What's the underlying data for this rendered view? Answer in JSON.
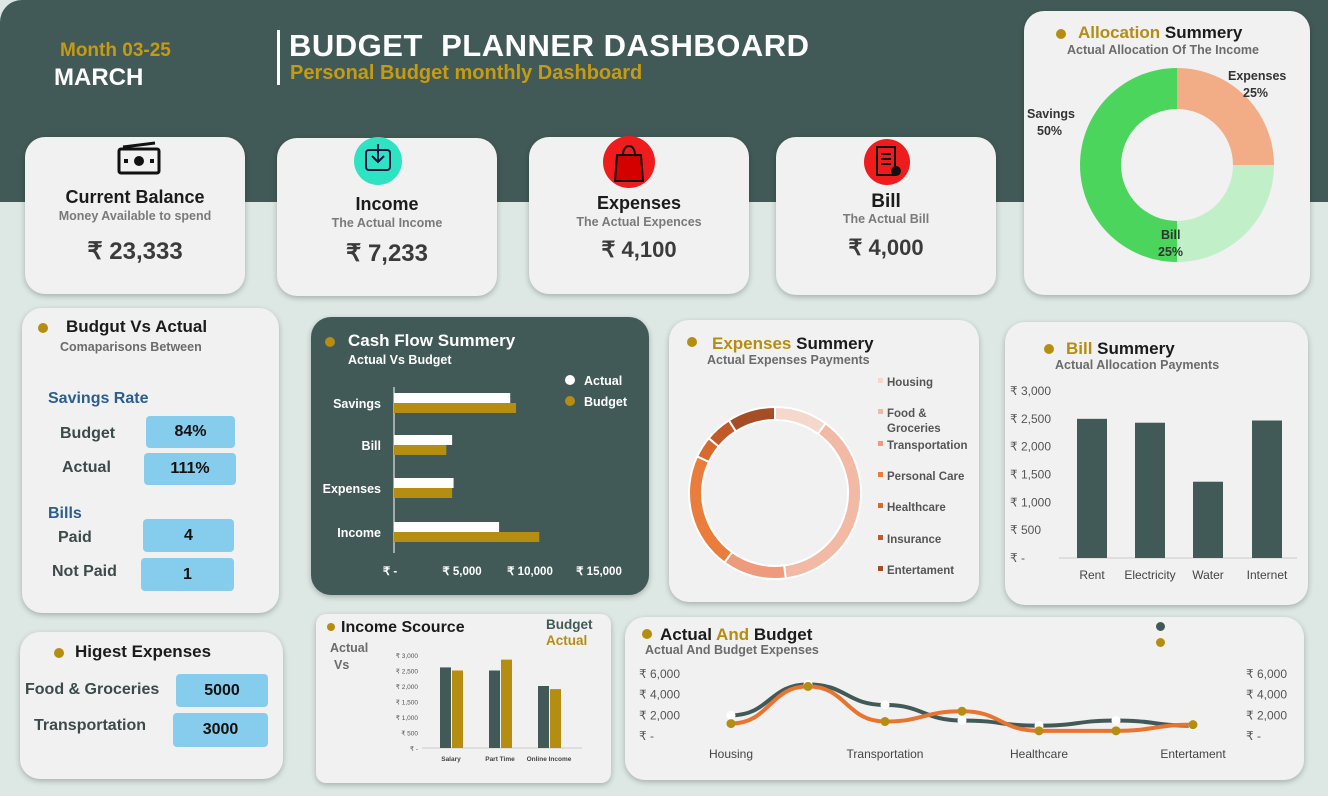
{
  "header": {
    "month_code": "Month 03-25",
    "month_name": "MARCH",
    "title": "BUDGET  PLANNER DASHBOARD",
    "subtitle": "Personal Budget monthly Dashboard"
  },
  "kpis": [
    {
      "title": "Current Balance",
      "sub": "Money Available to spend",
      "value": "₹ 23,333",
      "icon": "cash-icon"
    },
    {
      "title": "Income",
      "sub": "The Actual Income",
      "value": "₹ 7,233",
      "icon": "income-download-icon"
    },
    {
      "title": "Expenses",
      "sub": "The Actual Expences",
      "value": "₹ 4,100",
      "icon": "shopping-bag-icon"
    },
    {
      "title": "Bill",
      "sub": "The Actual Bill",
      "value": "₹ 4,000",
      "icon": "receipt-icon"
    }
  ],
  "allocation": {
    "title_a": "Allocation",
    "title_b": " Summery",
    "sub": "Actual Allocation Of The Income",
    "labels": {
      "expenses": "Expenses",
      "expenses_pct": "25%",
      "savings": "Savings",
      "savings_pct": "50%",
      "bill": "Bill",
      "bill_pct": "25%"
    }
  },
  "budget_vs_actual": {
    "title": "Budgut Vs Actual",
    "sub": "Comaparisons Between",
    "savings_rate_label": "Savings Rate",
    "budget_label": "Budget",
    "budget_value": "84%",
    "actual_label": "Actual",
    "actual_value": "111%",
    "bills_label": "Bills",
    "paid_label": "Paid",
    "paid_value": "4",
    "notpaid_label": "Not Paid",
    "notpaid_value": "1"
  },
  "highest_expenses": {
    "title": "Higest Expenses",
    "items": [
      {
        "label": "Food & Groceries",
        "value": "5000"
      },
      {
        "label": "Transportation",
        "value": "3000"
      }
    ]
  },
  "cash_flow": {
    "title": "Cash Flow Summery",
    "sub": "Actual Vs Budget",
    "legend_actual": "Actual",
    "legend_budget": "Budget",
    "x_ticks": [
      "₹ -",
      "₹ 5,000",
      "₹ 10,000",
      "₹ 15,000"
    ]
  },
  "expenses_summary": {
    "title_a": "Expenses",
    "title_b": " Summery",
    "sub": "Actual Expenses Payments",
    "legend": [
      "Housing",
      "Food &",
      "Groceries",
      "Transportation",
      "Personal Care",
      "Healthcare",
      "Insurance",
      "Entertament"
    ]
  },
  "bill_summary": {
    "title_a": "Bill",
    "title_b": " Summery",
    "sub": "Actual Allocation Payments",
    "y_ticks": [
      "₹ 3,000",
      "₹ 2,500",
      "₹ 2,000",
      "₹ 1,500",
      "₹ 1,000",
      "₹ 500",
      "₹ -"
    ]
  },
  "income_source": {
    "title": "Income Scource",
    "left_a": "Actual",
    "left_b": "Vs",
    "legend_budget": "Budget",
    "legend_actual": "Actual",
    "y_ticks": [
      "₹ 3,000",
      "₹ 2,500",
      "₹ 2,000",
      "₹ 1,500",
      "₹ 1,000",
      "₹ 500",
      "₹ -"
    ]
  },
  "actual_budget": {
    "title_a": "Actual",
    "title_mid": " And ",
    "title_b": "Budget",
    "sub": "Actual And Budget Expenses",
    "y_ticks": [
      "₹ 6,000",
      "₹ 4,000",
      "₹ 2,000",
      "₹ -"
    ]
  },
  "chart_data": [
    {
      "type": "pie",
      "title": "Allocation Summery",
      "categories": [
        "Expenses",
        "Bill",
        "Savings"
      ],
      "values": [
        25,
        25,
        50
      ],
      "colors": [
        "#f3ad86",
        "#c1efc8",
        "#4bd55c"
      ]
    },
    {
      "type": "bar",
      "title": "Cash Flow Summery",
      "orientation": "horizontal",
      "categories": [
        "Savings",
        "Bill",
        "Expenses",
        "Income"
      ],
      "series": [
        {
          "name": "Actual",
          "values": [
            8000,
            4000,
            4100,
            7233
          ],
          "color": "#ffffff"
        },
        {
          "name": "Budget",
          "values": [
            8400,
            3600,
            4000,
            10000
          ],
          "color": "#b58d10"
        }
      ],
      "xlim": [
        0,
        17000
      ]
    },
    {
      "type": "pie",
      "title": "Expenses Summery",
      "categories": [
        "Housing",
        "Food & Groceries",
        "Transportation",
        "Personal Care",
        "Healthcare",
        "Insurance",
        "Entertament"
      ],
      "values": [
        10,
        38,
        12,
        22,
        4,
        5,
        9
      ],
      "colors": [
        "#f6d7cc",
        "#f2b9a4",
        "#ee9a7c",
        "#ea7c3c",
        "#d76a2f",
        "#c1592b",
        "#a64d25"
      ]
    },
    {
      "type": "bar",
      "title": "Bill Summery",
      "categories": [
        "Rent",
        "Electricity",
        "Water",
        "Internet"
      ],
      "values": [
        2500,
        2430,
        1370,
        2470
      ],
      "ylim": [
        0,
        3000
      ],
      "color": "#425a57"
    },
    {
      "type": "bar",
      "title": "Income Scource",
      "categories": [
        "Salary",
        "Part Time",
        "Online Income"
      ],
      "series": [
        {
          "name": "Actual",
          "values": [
            2600,
            2500,
            2000
          ],
          "color": "#425a57"
        },
        {
          "name": "Budget",
          "values": [
            2500,
            2850,
            1900
          ],
          "color": "#b58d10"
        }
      ],
      "ylim": [
        0,
        3000
      ]
    },
    {
      "type": "line",
      "title": "Actual And Budget",
      "categories": [
        "Housing",
        "Food & Groceries",
        "Transportation",
        "Personal Care",
        "Healthcare",
        "Insurance",
        "Entertament"
      ],
      "x_tick_labels": [
        "Housing",
        "Transportation",
        "Healthcare",
        "Entertament"
      ],
      "series": [
        {
          "values": [
            2000,
            5000,
            3000,
            1500,
            1000,
            1500,
            1000
          ],
          "color": "#425a57"
        },
        {
          "values": [
            1200,
            4800,
            1400,
            2400,
            500,
            500,
            1100
          ],
          "color": "#e8742f"
        }
      ],
      "ylim": [
        0,
        6000
      ]
    }
  ]
}
